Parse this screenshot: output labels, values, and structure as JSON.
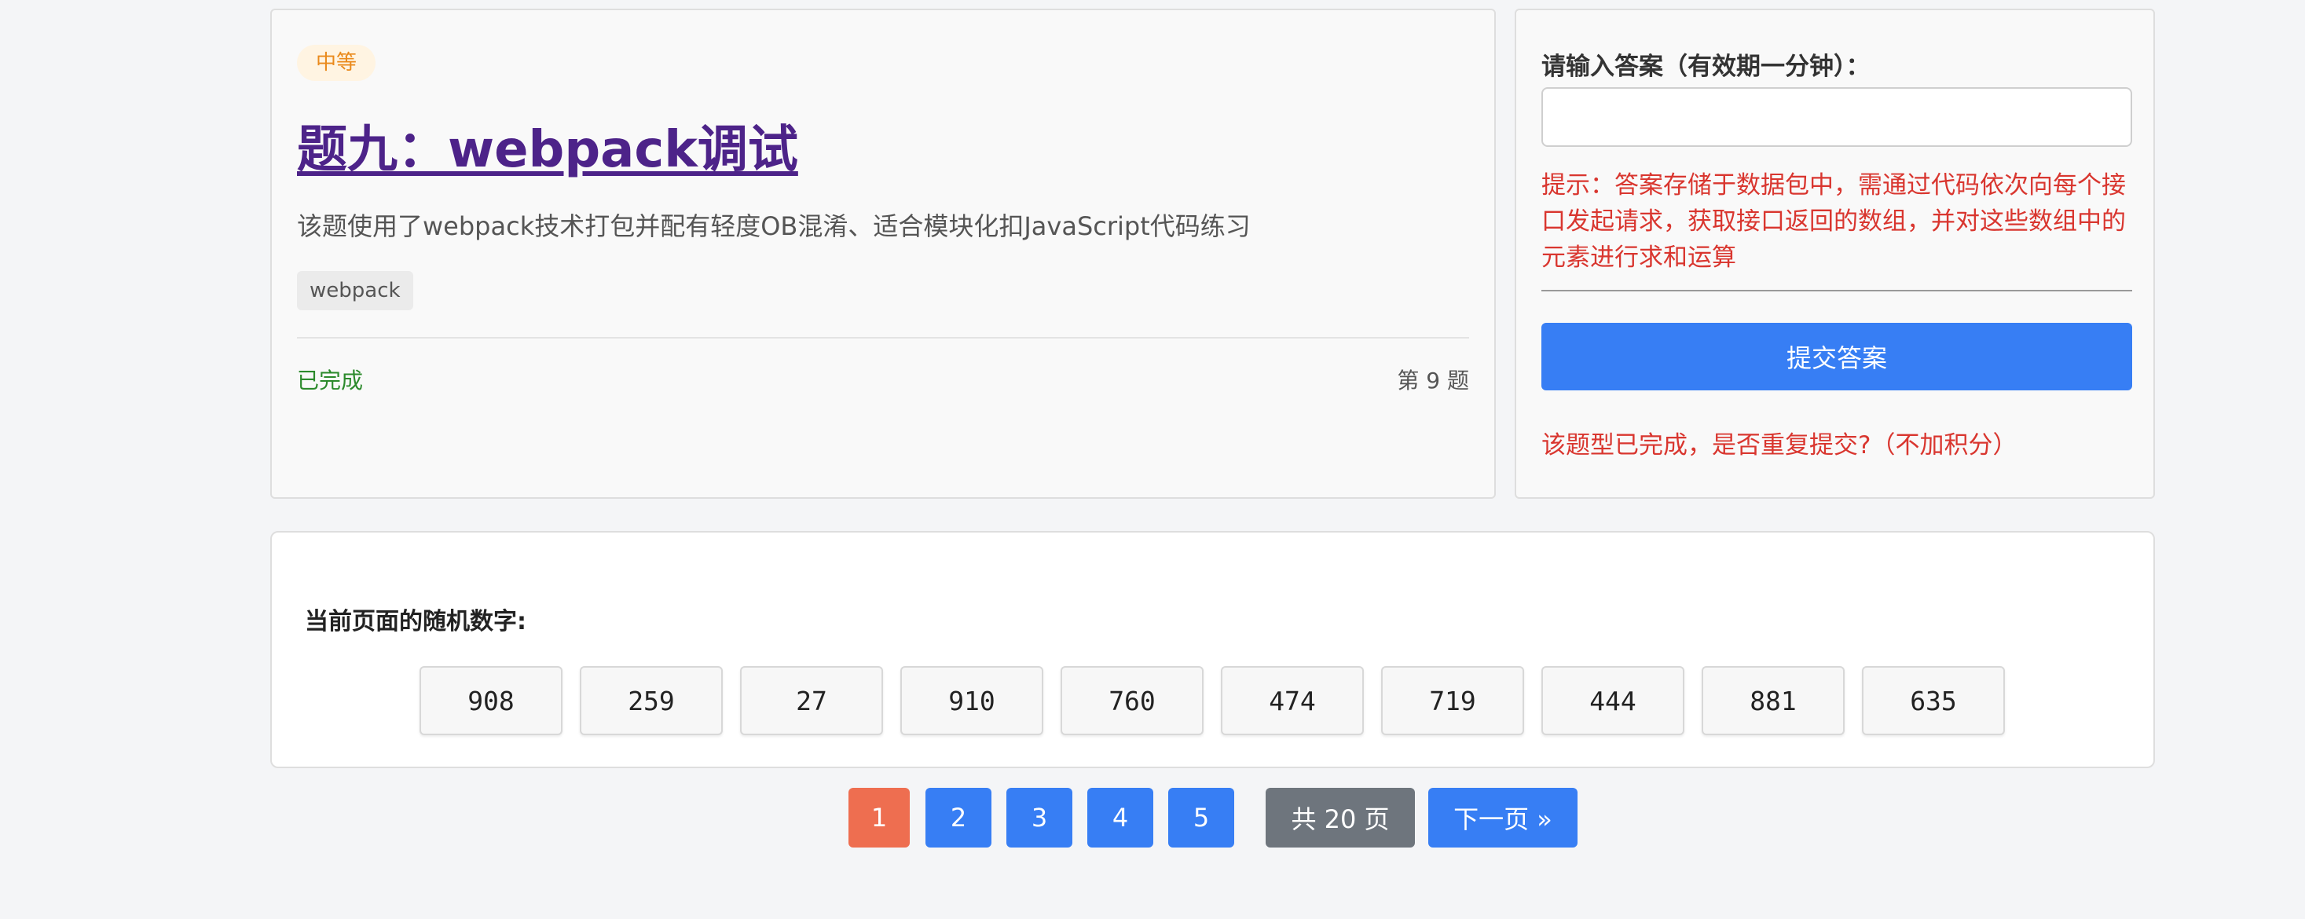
{
  "problem": {
    "difficulty": "中等",
    "title": "题九：webpack调试",
    "description": "该题使用了webpack技术打包并配有轻度OB混淆、适合模块化扣JavaScript代码练习",
    "tag": "webpack",
    "status": "已完成",
    "number_label": "第 9 题"
  },
  "answer": {
    "label": "请输入答案（有效期一分钟）：",
    "input_value": "",
    "hint": "提示：答案存储于数据包中，需通过代码依次向每个接口发起请求，获取接口返回的数组，并对这些数组中的元素进行求和运算",
    "submit_label": "提交答案",
    "repeat_notice": "该题型已完成，是否重复提交?（不加积分）"
  },
  "numbers": {
    "heading": "当前页面的随机数字:",
    "values": [
      "908",
      "259",
      "27",
      "910",
      "760",
      "474",
      "719",
      "444",
      "881",
      "635"
    ]
  },
  "pagination": {
    "pages": [
      "1",
      "2",
      "3",
      "4",
      "5"
    ],
    "current": "1",
    "total_label": "共 20 页",
    "next_label": "下一页 »"
  },
  "colors": {
    "accent": "#377ef4",
    "active_page": "#ee6e50",
    "hint_red": "#d9362f",
    "status_green": "#2c8a2c",
    "title_purple": "#4d2389"
  }
}
